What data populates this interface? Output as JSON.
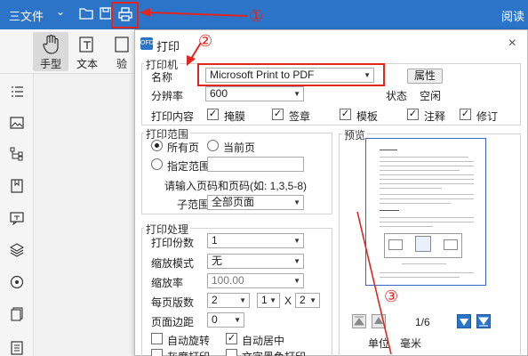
{
  "topbar": {
    "menu_label": "三文件",
    "read_label": "阅读"
  },
  "toolbar": {
    "hand_label": "手型",
    "text_label": "文本",
    "verify_label": "验"
  },
  "annotations": {
    "one": "①",
    "two": "②",
    "three": "③"
  },
  "dialog": {
    "logo": "OFD",
    "title": "打印",
    "close": "×",
    "printer": {
      "group_label": "打印机",
      "name_label": "名称",
      "name_value": "Microsoft Print to PDF",
      "props_label": "属性",
      "dpi_label": "分辨率",
      "dpi_value": "600",
      "status_label": "状态",
      "status_value": "空闲",
      "content_label": "打印内容",
      "content_items": [
        "掩膜",
        "签章",
        "模板",
        "注释",
        "修订"
      ]
    },
    "range": {
      "group_label": "打印范围",
      "all_pages": "所有页",
      "current_page": "当前页",
      "specific_range": "指定范围",
      "hint": "请输入页码和页码(如: 1,3,5-8)",
      "subrange_label": "子范围",
      "subrange_value": "全部页面"
    },
    "processing": {
      "group_label": "打印处理",
      "copies_label": "打印份数",
      "copies_value": "1",
      "scale_mode_label": "缩放模式",
      "scale_mode_value": "无",
      "scale_label": "缩放率",
      "scale_value": "100.00",
      "pages_per_sheet_label": "每页版数",
      "pps_a": "2",
      "pps_b": "1",
      "pps_x": "X",
      "pps_c": "2",
      "margin_label": "页面边距",
      "margin_value": "0",
      "auto_rotate": "自动旋转",
      "auto_center": "自动居中",
      "grayscale": "灰度打印",
      "text_black": "文字黑色打印"
    },
    "preview": {
      "label": "预览",
      "page_indicator": "1/6",
      "unit_label": "单位",
      "unit_value": "毫米"
    }
  },
  "colors": {
    "accent": "#2b74c8",
    "annotation_red": "#e0261e"
  }
}
